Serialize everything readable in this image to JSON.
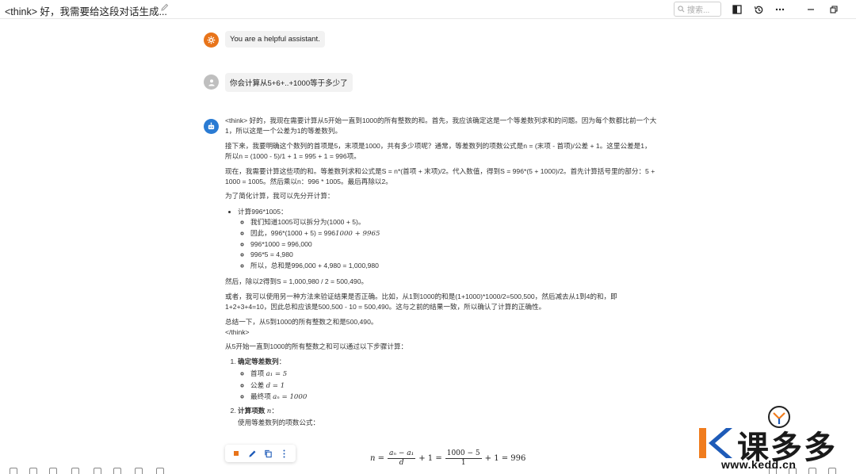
{
  "header": {
    "title": "<think> 好，我需要给这段对话生成...",
    "search_placeholder": "搜索..."
  },
  "messages": {
    "system": {
      "text": "You are a helpful assistant."
    },
    "user": {
      "text": "你会计算从5+6+..+1000等于多少了"
    },
    "assistant": {
      "p1": "<think> 好的，我现在需要计算从5开始一直到1000的所有整数的和。首先，我应该确定这是一个等差数列求和的问题。因为每个数都比前一个大1，所以这是一个公差为1的等差数列。",
      "p2": "接下来，我要明确这个数列的首项是5，末项是1000，共有多少项呢？通常，等差数列的项数公式是n = (末项 - 首项)/公差 + 1。这里公差是1，所以n = (1000 - 5)/1 + 1 = 995 + 1 = 996项。",
      "p3": "现在，我需要计算这些项的和。等差数列求和公式是S = n*(首项 + 末项)/2。代入数值，得到S = 996*(5 + 1000)/2。首先计算括号里的部分：5 + 1000 = 1005。然后乘以n：996 * 1005。最后再除以2。",
      "p4": "为了简化计算，我可以先分开计算：",
      "list_head": "计算996*1005：",
      "sub1": "我们知道1005可以拆分为(1000 + 5)。",
      "sub2_a": "因此，996*(1000 + 5) = 996",
      "sub2_b": "1000 + 996",
      "sub2_c": "5",
      "sub3": "996*1000 = 996,000",
      "sub4": "996*5 = 4,980",
      "sub5": "所以，总和是996,000 + 4,980 = 1,000,980",
      "p5": "然后，除以2得到S = 1,000,980 / 2 = 500,490。",
      "p6": "或者，我可以使用另一种方法来验证结果是否正确。比如，从1到1000的和是(1+1000)*1000/2=500,500，然后减去从1到4的和，即1+2+3+4=10，因此总和应该是500,500 - 10 = 500,490。这与之前的结果一致，所以确认了计算的正确性。",
      "p7": "总结一下，从5到1000的所有整数之和是500,490。",
      "p7b": "</think>",
      "p8": "从5开始一直到1000的所有整数之和可以通过以下步骤计算：",
      "step1_title": "确定等差数列",
      "step1_colon": "：",
      "step1_a_label": "首项 ",
      "step1_a_math": "a₁ = 5",
      "step1_b_label": "公差 ",
      "step1_b_math": "d = 1",
      "step1_c_label": "最终项 ",
      "step1_c_math": "aₙ = 1000",
      "step2_title": "计算项数 ",
      "step2_math": "n",
      "step2_colon": "：",
      "step2_desc": "使用等差数列的项数公式：",
      "formula": {
        "lhs": "n =",
        "frac1_num": "aₙ − a₁",
        "frac1_den": "d",
        "plus1": "+ 1 =",
        "frac2_num": "1000 − 5",
        "frac2_den": "1",
        "plus2": "+ 1 = 996"
      }
    }
  },
  "watermark": {
    "brand": "课多多",
    "url": "www.kedd.cn"
  },
  "colors": {
    "system_avatar": "#e8741a",
    "user_avatar": "#bfbfbf",
    "bot_avatar": "#2a7bd3",
    "logo_orange": "#f07c1e",
    "logo_blue": "#1e5bb8"
  }
}
